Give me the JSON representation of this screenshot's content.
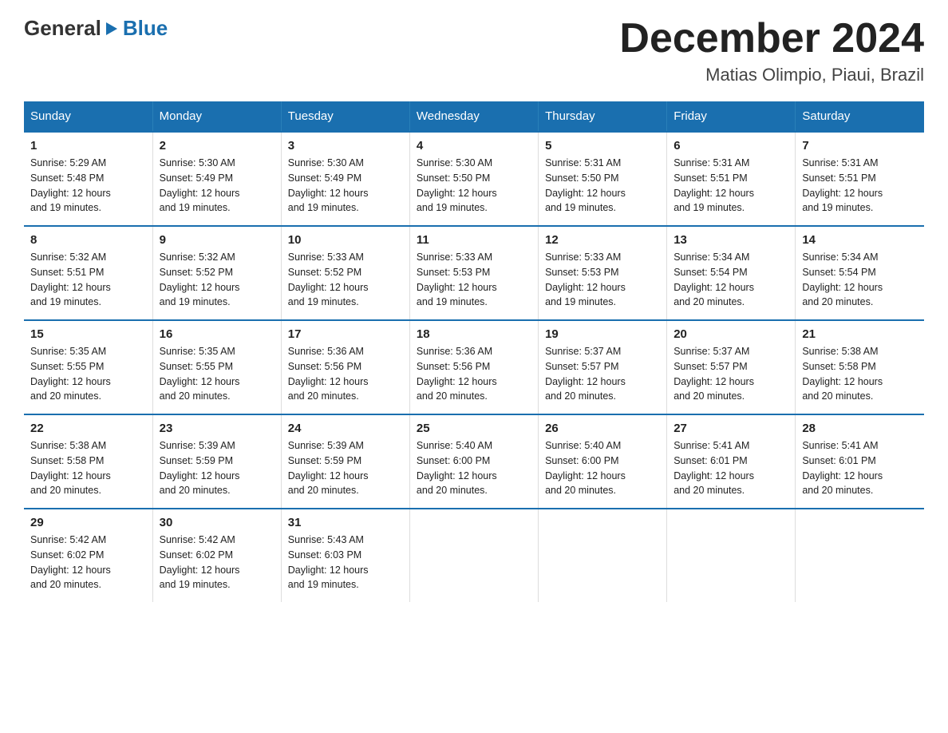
{
  "header": {
    "logo": {
      "general": "General",
      "arrow": "▶",
      "blue": "Blue"
    },
    "title": "December 2024",
    "subtitle": "Matias Olimpio, Piaui, Brazil"
  },
  "calendar": {
    "days_of_week": [
      "Sunday",
      "Monday",
      "Tuesday",
      "Wednesday",
      "Thursday",
      "Friday",
      "Saturday"
    ],
    "weeks": [
      [
        {
          "day": "1",
          "sunrise": "5:29 AM",
          "sunset": "5:48 PM",
          "daylight": "12 hours and 19 minutes."
        },
        {
          "day": "2",
          "sunrise": "5:30 AM",
          "sunset": "5:49 PM",
          "daylight": "12 hours and 19 minutes."
        },
        {
          "day": "3",
          "sunrise": "5:30 AM",
          "sunset": "5:49 PM",
          "daylight": "12 hours and 19 minutes."
        },
        {
          "day": "4",
          "sunrise": "5:30 AM",
          "sunset": "5:50 PM",
          "daylight": "12 hours and 19 minutes."
        },
        {
          "day": "5",
          "sunrise": "5:31 AM",
          "sunset": "5:50 PM",
          "daylight": "12 hours and 19 minutes."
        },
        {
          "day": "6",
          "sunrise": "5:31 AM",
          "sunset": "5:51 PM",
          "daylight": "12 hours and 19 minutes."
        },
        {
          "day": "7",
          "sunrise": "5:31 AM",
          "sunset": "5:51 PM",
          "daylight": "12 hours and 19 minutes."
        }
      ],
      [
        {
          "day": "8",
          "sunrise": "5:32 AM",
          "sunset": "5:51 PM",
          "daylight": "12 hours and 19 minutes."
        },
        {
          "day": "9",
          "sunrise": "5:32 AM",
          "sunset": "5:52 PM",
          "daylight": "12 hours and 19 minutes."
        },
        {
          "day": "10",
          "sunrise": "5:33 AM",
          "sunset": "5:52 PM",
          "daylight": "12 hours and 19 minutes."
        },
        {
          "day": "11",
          "sunrise": "5:33 AM",
          "sunset": "5:53 PM",
          "daylight": "12 hours and 19 minutes."
        },
        {
          "day": "12",
          "sunrise": "5:33 AM",
          "sunset": "5:53 PM",
          "daylight": "12 hours and 19 minutes."
        },
        {
          "day": "13",
          "sunrise": "5:34 AM",
          "sunset": "5:54 PM",
          "daylight": "12 hours and 20 minutes."
        },
        {
          "day": "14",
          "sunrise": "5:34 AM",
          "sunset": "5:54 PM",
          "daylight": "12 hours and 20 minutes."
        }
      ],
      [
        {
          "day": "15",
          "sunrise": "5:35 AM",
          "sunset": "5:55 PM",
          "daylight": "12 hours and 20 minutes."
        },
        {
          "day": "16",
          "sunrise": "5:35 AM",
          "sunset": "5:55 PM",
          "daylight": "12 hours and 20 minutes."
        },
        {
          "day": "17",
          "sunrise": "5:36 AM",
          "sunset": "5:56 PM",
          "daylight": "12 hours and 20 minutes."
        },
        {
          "day": "18",
          "sunrise": "5:36 AM",
          "sunset": "5:56 PM",
          "daylight": "12 hours and 20 minutes."
        },
        {
          "day": "19",
          "sunrise": "5:37 AM",
          "sunset": "5:57 PM",
          "daylight": "12 hours and 20 minutes."
        },
        {
          "day": "20",
          "sunrise": "5:37 AM",
          "sunset": "5:57 PM",
          "daylight": "12 hours and 20 minutes."
        },
        {
          "day": "21",
          "sunrise": "5:38 AM",
          "sunset": "5:58 PM",
          "daylight": "12 hours and 20 minutes."
        }
      ],
      [
        {
          "day": "22",
          "sunrise": "5:38 AM",
          "sunset": "5:58 PM",
          "daylight": "12 hours and 20 minutes."
        },
        {
          "day": "23",
          "sunrise": "5:39 AM",
          "sunset": "5:59 PM",
          "daylight": "12 hours and 20 minutes."
        },
        {
          "day": "24",
          "sunrise": "5:39 AM",
          "sunset": "5:59 PM",
          "daylight": "12 hours and 20 minutes."
        },
        {
          "day": "25",
          "sunrise": "5:40 AM",
          "sunset": "6:00 PM",
          "daylight": "12 hours and 20 minutes."
        },
        {
          "day": "26",
          "sunrise": "5:40 AM",
          "sunset": "6:00 PM",
          "daylight": "12 hours and 20 minutes."
        },
        {
          "day": "27",
          "sunrise": "5:41 AM",
          "sunset": "6:01 PM",
          "daylight": "12 hours and 20 minutes."
        },
        {
          "day": "28",
          "sunrise": "5:41 AM",
          "sunset": "6:01 PM",
          "daylight": "12 hours and 20 minutes."
        }
      ],
      [
        {
          "day": "29",
          "sunrise": "5:42 AM",
          "sunset": "6:02 PM",
          "daylight": "12 hours and 20 minutes."
        },
        {
          "day": "30",
          "sunrise": "5:42 AM",
          "sunset": "6:02 PM",
          "daylight": "12 hours and 19 minutes."
        },
        {
          "day": "31",
          "sunrise": "5:43 AM",
          "sunset": "6:03 PM",
          "daylight": "12 hours and 19 minutes."
        },
        null,
        null,
        null,
        null
      ]
    ],
    "labels": {
      "sunrise": "Sunrise:",
      "sunset": "Sunset:",
      "daylight": "Daylight:"
    }
  }
}
